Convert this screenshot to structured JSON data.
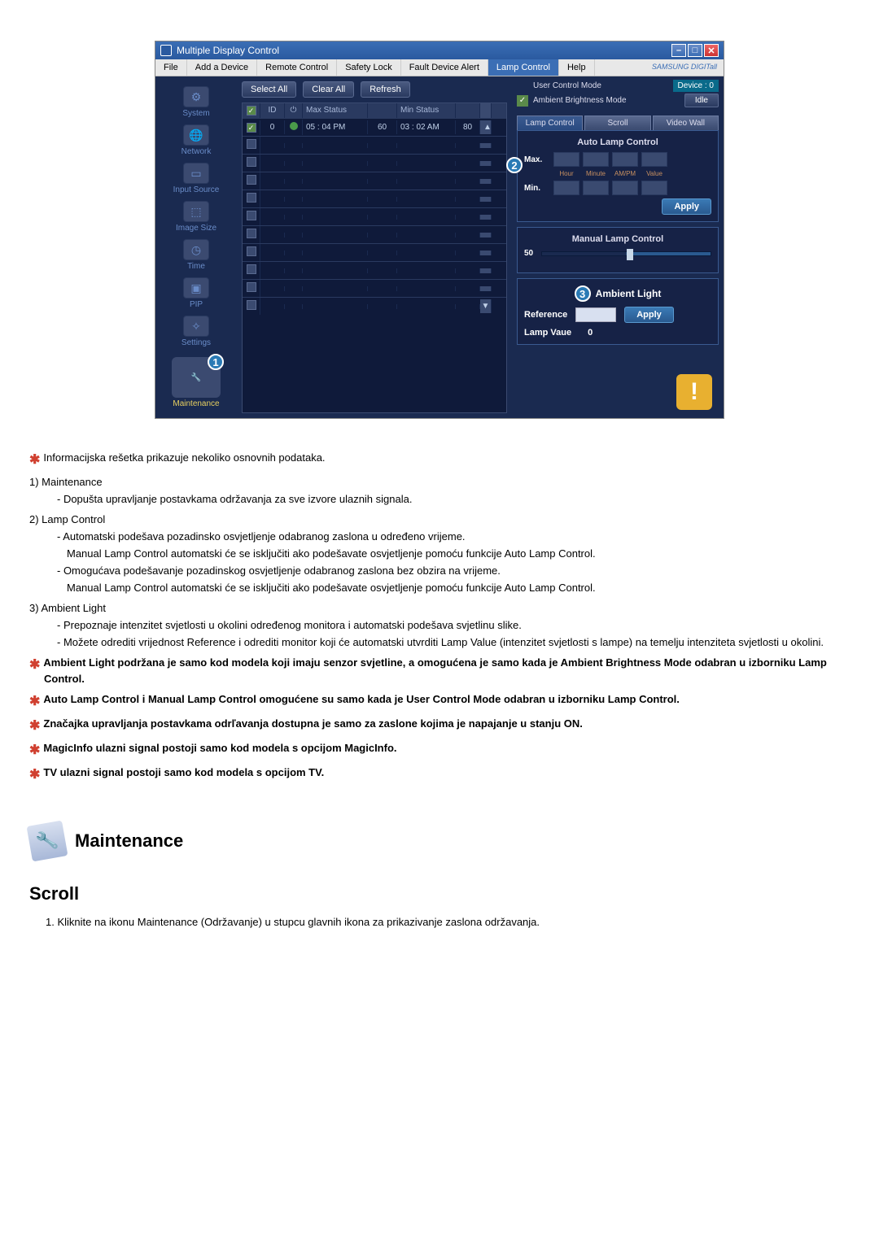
{
  "window": {
    "title": "Multiple Display Control"
  },
  "menubar": {
    "file": "File",
    "addDevice": "Add a Device",
    "remoteControl": "Remote Control",
    "safetyLock": "Safety Lock",
    "faultDeviceAlert": "Fault Device Alert",
    "lampControl": "Lamp Control",
    "help": "Help",
    "brand": "SAMSUNG DIGITall"
  },
  "sidebar": {
    "items": [
      {
        "label": "System",
        "glyph": "⚙"
      },
      {
        "label": "Network",
        "glyph": "🌐"
      },
      {
        "label": "Input Source",
        "glyph": "▭"
      },
      {
        "label": "Image Size",
        "glyph": "⬚"
      },
      {
        "label": "Time",
        "glyph": "◷"
      },
      {
        "label": "PIP",
        "glyph": "▣"
      },
      {
        "label": "Settings",
        "glyph": "✧"
      }
    ],
    "maintenanceLabel": "Maintenance"
  },
  "callouts": {
    "one": "1",
    "two": "2",
    "three": "3"
  },
  "toolbar": {
    "selectAll": "Select All",
    "clearAll": "Clear All",
    "refresh": "Refresh"
  },
  "grid": {
    "headers": {
      "id": "ID",
      "maxStatus": "Max Status",
      "minStatus": "Min Status"
    },
    "row": {
      "id": "0",
      "maxStatus": "05 : 04  PM",
      "maxVal": "60",
      "minStatus": "03 : 02  AM",
      "minVal": "80"
    }
  },
  "rightPanel": {
    "userControlMode": "User Control Mode",
    "ambientBrightnessMode": "Ambient Brightness Mode",
    "deviceLabel": "Device : 0",
    "idle": "Idle",
    "tabs": {
      "lampControl": "Lamp Control",
      "scroll": "Scroll",
      "videoWall": "Video Wall"
    },
    "autoLamp": {
      "title": "Auto Lamp Control",
      "max": "Max.",
      "min": "Min.",
      "sub": {
        "hour": "Hour",
        "minute": "Minute",
        "ampm": "AM/PM",
        "value": "Value"
      },
      "apply": "Apply"
    },
    "manualLamp": {
      "title": "Manual Lamp Control",
      "value": "50"
    },
    "ambientLight": {
      "title": "Ambient Light",
      "reference": "Reference",
      "apply": "Apply",
      "lampValueLabel": "Lamp Vaue",
      "lampValue": "0"
    }
  },
  "doc": {
    "intro": "Informacijska rešetka prikazuje nekoliko osnovnih podataka.",
    "h1": "1)  Maintenance",
    "h1_b1": "- Dopušta upravljanje postavkama održavanja za sve izvore ulaznih signala.",
    "h2": "2)  Lamp Control",
    "h2_b1": "- Automatski podešava pozadinsko osvjetljenje odabranog zaslona u određeno vrijeme.",
    "h2_b1c": "Manual Lamp Control automatski će se isključiti ako podešavate osvjetljenje pomoću funkcije Auto Lamp Control.",
    "h2_b2": "- Omogućava podešavanje pozadinskog osvjetljenje odabranog zaslona bez obzira na vrijeme.",
    "h2_b2c": "Manual Lamp Control automatski će se isključiti ako podešavate osvjetljenje pomoću funkcije Auto Lamp Control.",
    "h3": "3)  Ambient Light",
    "h3_b1": "- Prepoznaje intenzitet svjetlosti u okolini određenog monitora i automatski podešava svjetlinu slike.",
    "h3_b2": "- Možete odrediti vrijednost Reference i odrediti monitor koji će automatski utvrditi Lamp Value (intenzitet svjetlosti s lampe) na temelju intenziteta svjetlosti u okolini.",
    "note1": "Ambient Light podržana je samo kod modela koji imaju senzor svjetline, a omogućena je samo kada je Ambient Brightness Mode odabran u izborniku Lamp Control.",
    "note2": "Auto Lamp Control i Manual Lamp Control omogućene su samo kada je User Control Mode odabran u izborniku Lamp Control.",
    "note3": "Značajka upravljanja postavkama odrľavanja dostupna je samo za zaslone kojima je napajanje u stanju ON.",
    "note4": "MagicInfo ulazni signal postoji samo kod modela s opcijom MagicInfo.",
    "note5": "TV ulazni signal postoji samo kod modela s opcijom TV.",
    "maintHeading": "Maintenance",
    "scrollHeading": "Scroll",
    "step1": "1.  Kliknite na ikonu Maintenance (Održavanje) u stupcu glavnih ikona za prikazivanje zaslona održavanja."
  }
}
